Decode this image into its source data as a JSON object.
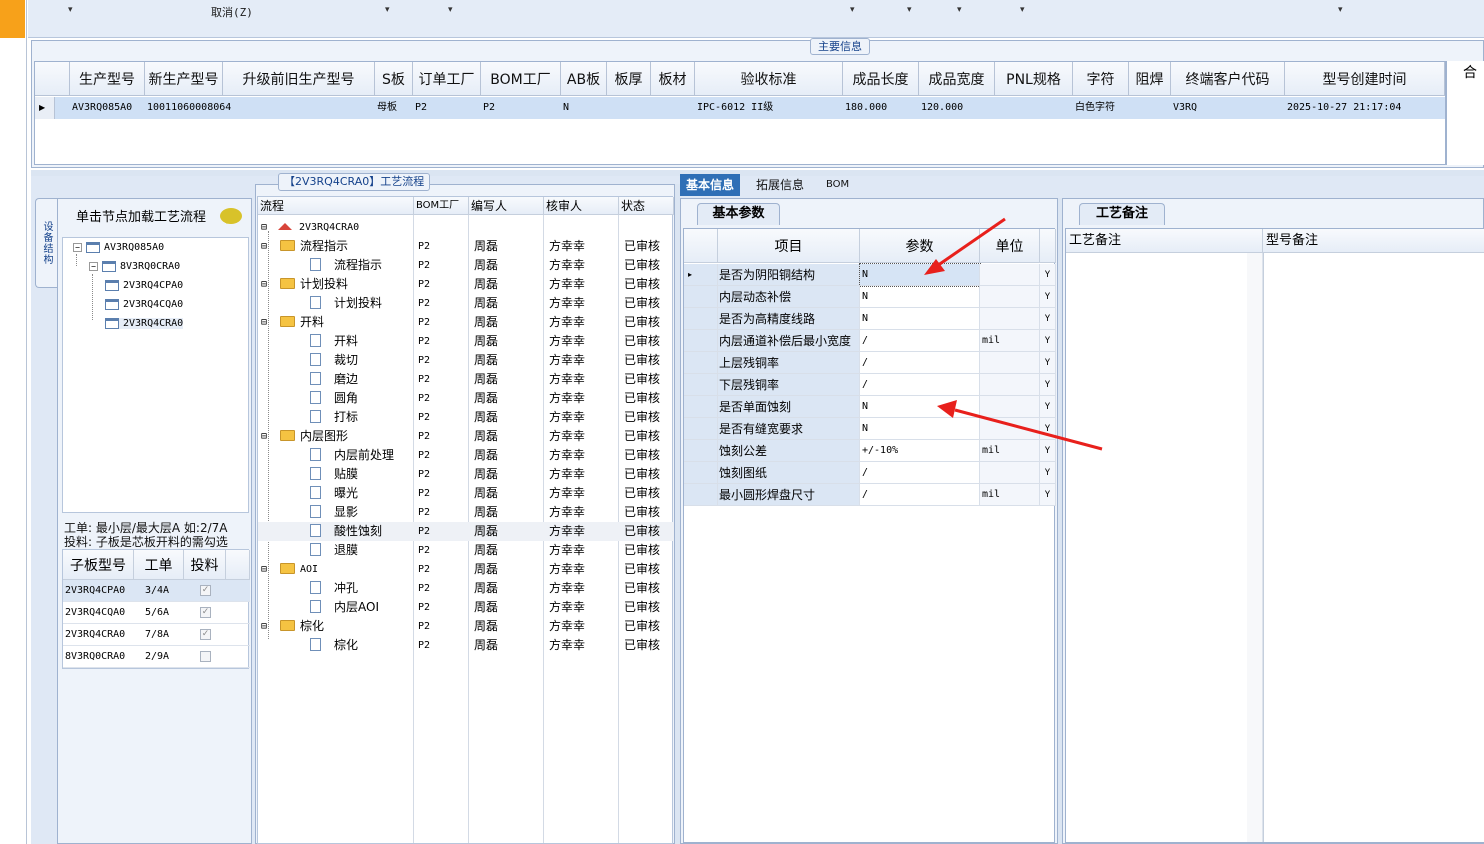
{
  "toolbar": {
    "cancel_label": "取消(Z)",
    "dropdown_glyph": "▾"
  },
  "main_panel": {
    "title": "主要信息",
    "columns": [
      "生产型号",
      "新生产型号",
      "升级前旧生产型号",
      "S板",
      "订单工厂",
      "BOM工厂",
      "AB板",
      "板厚",
      "板材",
      "验收标准",
      "成品长度",
      "成品宽度",
      "PNL规格",
      "字符",
      "阻焊",
      "终端客户代码",
      "型号创建时间",
      "合"
    ],
    "row": {
      "生产型号": "AV3RQ085A0",
      "新生产型号": "10011060008064",
      "升级前旧生产型号": "",
      "S板": "母板",
      "订单工厂": "P2",
      "BOM工厂": "P2",
      "AB板": "N",
      "板厚": "",
      "板材": "",
      "验收标准": "IPC-6012 II级",
      "成品长度": "180.000",
      "成品宽度": "120.000",
      "PNL规格": "",
      "字符": "白色字符",
      "阻焊": "",
      "终端客户代码": "V3RQ",
      "型号创建时间": "2025-10-27 21:17:04"
    },
    "row_marker": "▶"
  },
  "side_tab": "设备结构",
  "tree_panel": {
    "header": "单击节点加载工艺流程",
    "nodes": [
      "AV3RQ085A0",
      "8V3RQ0CRA0",
      "2V3RQ4CPA0",
      "2V3RQ4CQA0",
      "2V3RQ4CRA0"
    ],
    "notes": [
      "工单: 最小层/最大层A 如:2/7A",
      "投料: 子板是芯板开料的需勾选"
    ],
    "sub_columns": [
      "子板型号",
      "工单",
      "投料"
    ],
    "sub_rows": [
      {
        "model": "2V3RQ4CPA0",
        "order": "3/4A",
        "checked": true
      },
      {
        "model": "2V3RQ4CQA0",
        "order": "5/6A",
        "checked": true
      },
      {
        "model": "2V3RQ4CRA0",
        "order": "7/8A",
        "checked": true
      },
      {
        "model": "8V3RQ0CRA0",
        "order": "2/9A",
        "checked": false
      }
    ]
  },
  "flow_panel": {
    "title": "【2V3RQ4CRA0】工艺流程",
    "columns": [
      "流程",
      "BOM工厂",
      "编写人",
      "核审人",
      "状态"
    ],
    "root": "2V3RQ4CRA0",
    "rows": [
      {
        "name": "流程指示",
        "level": 1,
        "factory": "P2",
        "writer": "周磊",
        "reviewer": "方幸幸",
        "status": "已审核"
      },
      {
        "name": "流程指示",
        "level": 2,
        "factory": "P2",
        "writer": "周磊",
        "reviewer": "方幸幸",
        "status": "已审核"
      },
      {
        "name": "计划投料",
        "level": 1,
        "factory": "P2",
        "writer": "周磊",
        "reviewer": "方幸幸",
        "status": "已审核"
      },
      {
        "name": "计划投料",
        "level": 2,
        "factory": "P2",
        "writer": "周磊",
        "reviewer": "方幸幸",
        "status": "已审核"
      },
      {
        "name": "开料",
        "level": 1,
        "factory": "P2",
        "writer": "周磊",
        "reviewer": "方幸幸",
        "status": "已审核"
      },
      {
        "name": "开料",
        "level": 2,
        "factory": "P2",
        "writer": "周磊",
        "reviewer": "方幸幸",
        "status": "已审核"
      },
      {
        "name": "裁切",
        "level": 2,
        "factory": "P2",
        "writer": "周磊",
        "reviewer": "方幸幸",
        "status": "已审核"
      },
      {
        "name": "磨边",
        "level": 2,
        "factory": "P2",
        "writer": "周磊",
        "reviewer": "方幸幸",
        "status": "已审核"
      },
      {
        "name": "圆角",
        "level": 2,
        "factory": "P2",
        "writer": "周磊",
        "reviewer": "方幸幸",
        "status": "已审核"
      },
      {
        "name": "打标",
        "level": 2,
        "factory": "P2",
        "writer": "周磊",
        "reviewer": "方幸幸",
        "status": "已审核"
      },
      {
        "name": "内层图形",
        "level": 1,
        "factory": "P2",
        "writer": "周磊",
        "reviewer": "方幸幸",
        "status": "已审核"
      },
      {
        "name": "内层前处理",
        "level": 2,
        "factory": "P2",
        "writer": "周磊",
        "reviewer": "方幸幸",
        "status": "已审核"
      },
      {
        "name": "贴膜",
        "level": 2,
        "factory": "P2",
        "writer": "周磊",
        "reviewer": "方幸幸",
        "status": "已审核"
      },
      {
        "name": "曝光",
        "level": 2,
        "factory": "P2",
        "writer": "周磊",
        "reviewer": "方幸幸",
        "status": "已审核"
      },
      {
        "name": "显影",
        "level": 2,
        "factory": "P2",
        "writer": "周磊",
        "reviewer": "方幸幸",
        "status": "已审核"
      },
      {
        "name": "酸性蚀刻",
        "level": 2,
        "factory": "P2",
        "writer": "周磊",
        "reviewer": "方幸幸",
        "status": "已审核"
      },
      {
        "name": "退膜",
        "level": 2,
        "factory": "P2",
        "writer": "周磊",
        "reviewer": "方幸幸",
        "status": "已审核"
      },
      {
        "name": "AOI",
        "level": 1,
        "factory": "P2",
        "writer": "周磊",
        "reviewer": "方幸幸",
        "status": "已审核"
      },
      {
        "name": "冲孔",
        "level": 2,
        "factory": "P2",
        "writer": "周磊",
        "reviewer": "方幸幸",
        "status": "已审核"
      },
      {
        "name": "内层AOI",
        "level": 2,
        "factory": "P2",
        "writer": "周磊",
        "reviewer": "方幸幸",
        "status": "已审核"
      },
      {
        "name": "棕化",
        "level": 1,
        "factory": "P2",
        "writer": "周磊",
        "reviewer": "方幸幸",
        "status": "已审核"
      },
      {
        "name": "棕化",
        "level": 2,
        "factory": "P2",
        "writer": "周磊",
        "reviewer": "方幸幸",
        "status": "已审核"
      }
    ]
  },
  "tabs": [
    "基本信息",
    "拓展信息",
    "BOM"
  ],
  "basic_params": {
    "tab_label": "基本参数",
    "columns": [
      "项目",
      "参数",
      "单位"
    ],
    "rows": [
      {
        "item": "是否为阴阳铜结构",
        "value": "N",
        "unit": "",
        "flag": "Y"
      },
      {
        "item": "内层动态补偿",
        "value": "N",
        "unit": "",
        "flag": "Y"
      },
      {
        "item": "是否为高精度线路",
        "value": "N",
        "unit": "",
        "flag": "Y"
      },
      {
        "item": "内层通道补偿后最小宽度",
        "value": "/",
        "unit": "mil",
        "flag": "Y"
      },
      {
        "item": "上层残铜率",
        "value": "/",
        "unit": "",
        "flag": "Y"
      },
      {
        "item": "下层残铜率",
        "value": "/",
        "unit": "",
        "flag": "Y"
      },
      {
        "item": "是否单面蚀刻",
        "value": "N",
        "unit": "",
        "flag": "Y"
      },
      {
        "item": "是否有缝宽要求",
        "value": "N",
        "unit": "",
        "flag": "Y"
      },
      {
        "item": "蚀刻公差",
        "value": "+/-10%",
        "unit": "mil",
        "flag": "Y"
      },
      {
        "item": "蚀刻图纸",
        "value": "/",
        "unit": "",
        "flag": "Y"
      },
      {
        "item": "最小圆形焊盘尺寸",
        "value": "/",
        "unit": "mil",
        "flag": "Y"
      }
    ]
  },
  "notes_panel": {
    "tab_label": "工艺备注",
    "columns": [
      "工艺备注",
      "型号备注"
    ]
  },
  "colors": {
    "accent": "#2f6fb6",
    "arrow": "#e8201c",
    "folder": "#f5c342"
  }
}
